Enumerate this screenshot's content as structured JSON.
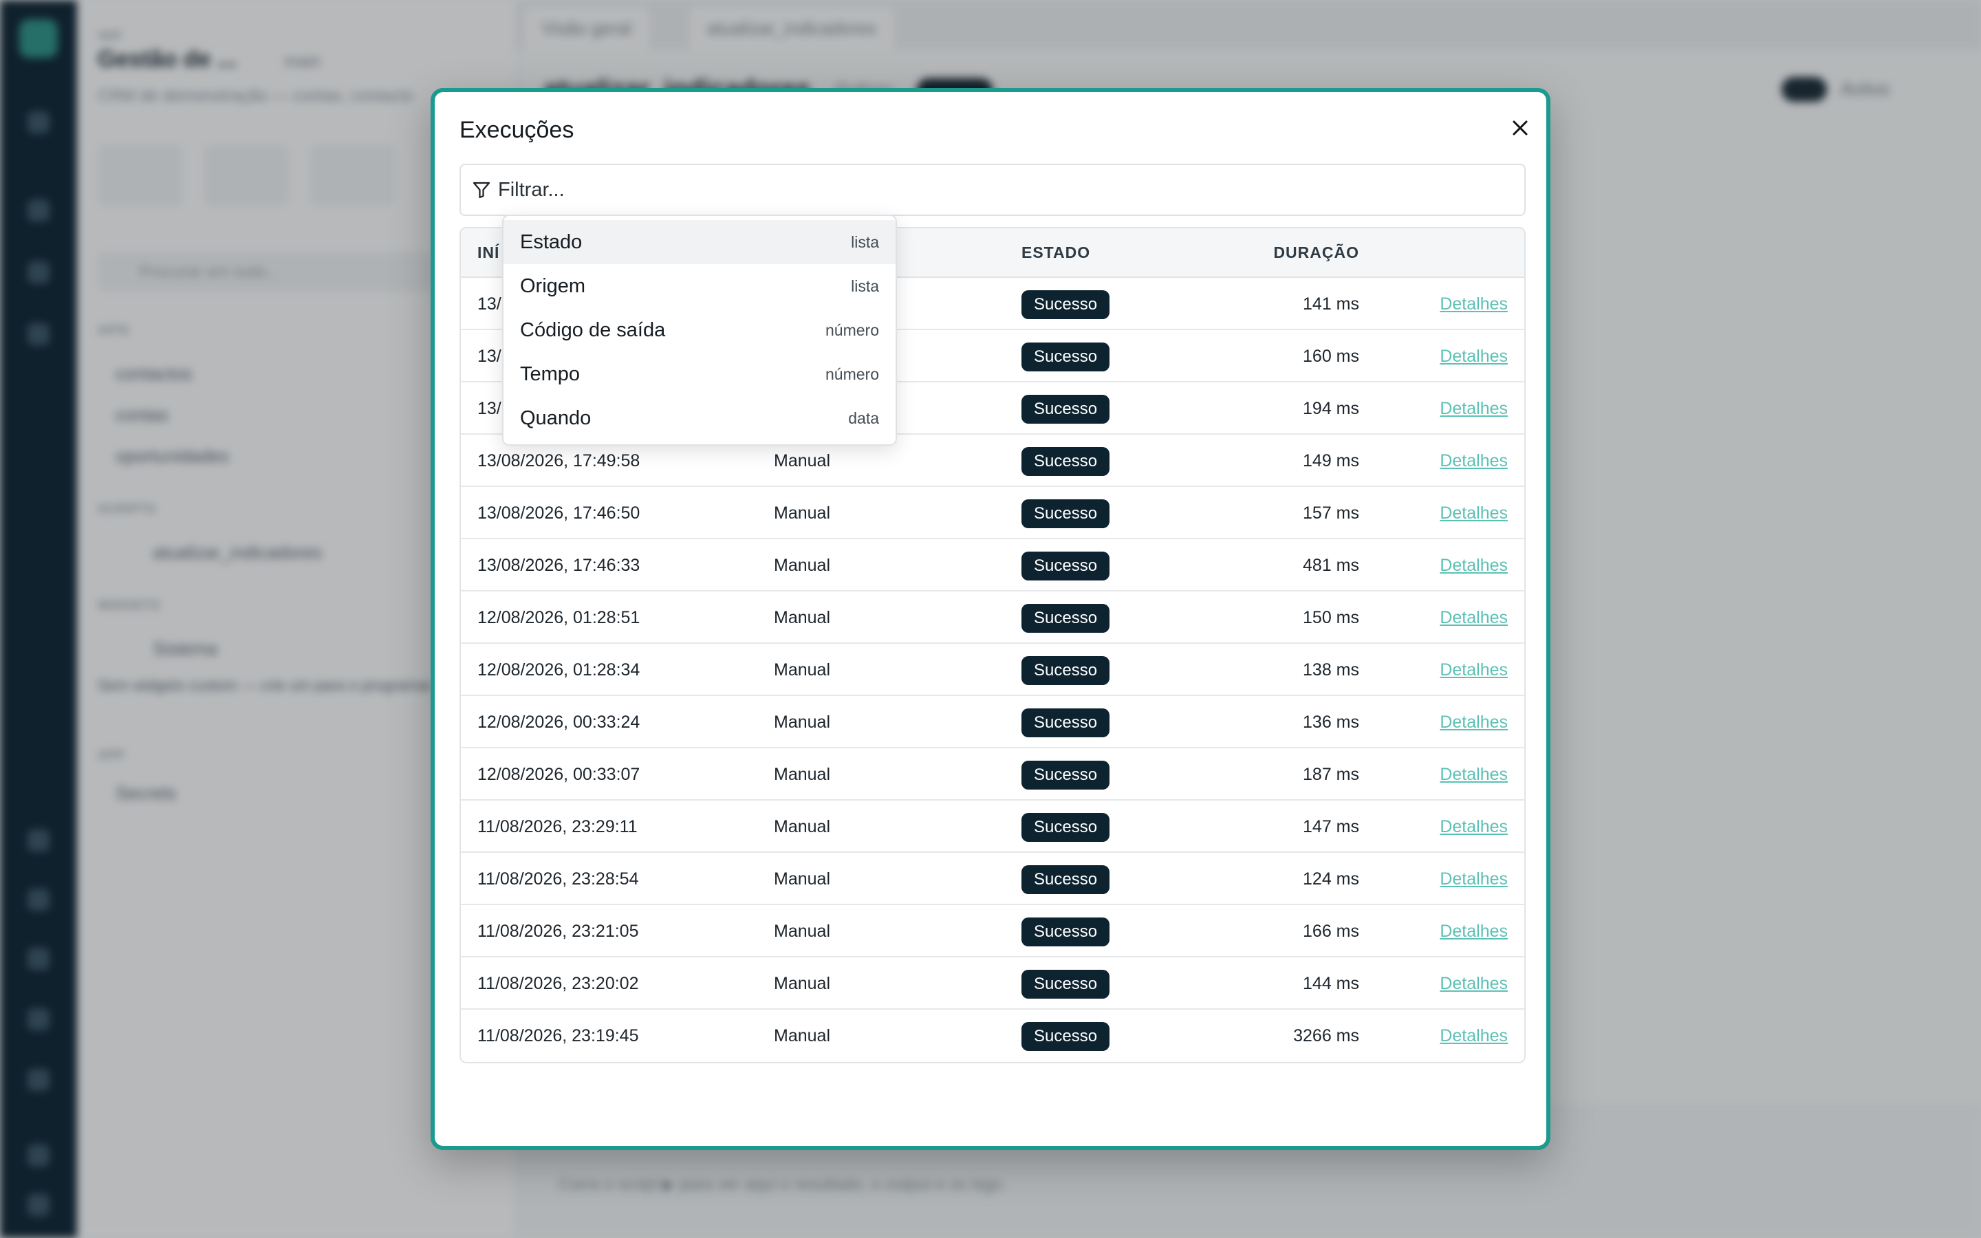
{
  "background": {
    "panel_kicker": "appl",
    "panel_title": "Gestão de ...",
    "panel_branch": "main",
    "panel_desc": "CRM de demonstração — contas, contacto",
    "search_placeholder": "Procurar em tudo...",
    "sections": [
      "APIS",
      "SCRIPTS",
      "WIDGETS",
      "APP"
    ],
    "api_items": [
      "contactos",
      "contas",
      "oportunidades"
    ],
    "script_item": "atualizar_indicadores",
    "widget_item": "Sistema",
    "widget_note": "Sem widgets custom — crie um para o programar.",
    "app_item": "Secrets",
    "tabs": [
      "Visão geral",
      "atualizar_indicadores"
    ],
    "main_title": "atualizar_indicadores",
    "main_subtitle": "Python",
    "toggle_label": "Activo",
    "footer_text": "Corra o script ▶ para ver aqui o resultado, o output e os logs."
  },
  "modal": {
    "title": "Execuções",
    "close_icon": "close-icon",
    "filter_placeholder": "Filtrar..."
  },
  "filter_menu": [
    {
      "label": "Estado",
      "type": "lista"
    },
    {
      "label": "Origem",
      "type": "lista"
    },
    {
      "label": "Código de saída",
      "type": "número"
    },
    {
      "label": "Tempo",
      "type": "número"
    },
    {
      "label": "Quando",
      "type": "data"
    }
  ],
  "table": {
    "headers": {
      "start": "INÍ",
      "state": "ESTADO",
      "duration": "DURAÇÃO"
    },
    "rows": [
      {
        "start": "13/",
        "origin": "",
        "state": "Sucesso",
        "duration": "141 ms",
        "details": "Detalhes"
      },
      {
        "start": "13/",
        "origin": "",
        "state": "Sucesso",
        "duration": "160 ms",
        "details": "Detalhes"
      },
      {
        "start": "13/",
        "origin": "",
        "state": "Sucesso",
        "duration": "194 ms",
        "details": "Detalhes"
      },
      {
        "start": "13/08/2026, 17:49:58",
        "origin": "Manual",
        "state": "Sucesso",
        "duration": "149 ms",
        "details": "Detalhes"
      },
      {
        "start": "13/08/2026, 17:46:50",
        "origin": "Manual",
        "state": "Sucesso",
        "duration": "157 ms",
        "details": "Detalhes"
      },
      {
        "start": "13/08/2026, 17:46:33",
        "origin": "Manual",
        "state": "Sucesso",
        "duration": "481 ms",
        "details": "Detalhes"
      },
      {
        "start": "12/08/2026, 01:28:51",
        "origin": "Manual",
        "state": "Sucesso",
        "duration": "150 ms",
        "details": "Detalhes"
      },
      {
        "start": "12/08/2026, 01:28:34",
        "origin": "Manual",
        "state": "Sucesso",
        "duration": "138 ms",
        "details": "Detalhes"
      },
      {
        "start": "12/08/2026, 00:33:24",
        "origin": "Manual",
        "state": "Sucesso",
        "duration": "136 ms",
        "details": "Detalhes"
      },
      {
        "start": "12/08/2026, 00:33:07",
        "origin": "Manual",
        "state": "Sucesso",
        "duration": "187 ms",
        "details": "Detalhes"
      },
      {
        "start": "11/08/2026, 23:29:11",
        "origin": "Manual",
        "state": "Sucesso",
        "duration": "147 ms",
        "details": "Detalhes"
      },
      {
        "start": "11/08/2026, 23:28:54",
        "origin": "Manual",
        "state": "Sucesso",
        "duration": "124 ms",
        "details": "Detalhes"
      },
      {
        "start": "11/08/2026, 23:21:05",
        "origin": "Manual",
        "state": "Sucesso",
        "duration": "166 ms",
        "details": "Detalhes"
      },
      {
        "start": "11/08/2026, 23:20:02",
        "origin": "Manual",
        "state": "Sucesso",
        "duration": "144 ms",
        "details": "Detalhes"
      },
      {
        "start": "11/08/2026, 23:19:45",
        "origin": "Manual",
        "state": "Sucesso",
        "duration": "3266 ms",
        "details": "Detalhes"
      }
    ]
  },
  "colors": {
    "accent": "#1b9a8e",
    "badge_bg": "#0e2330",
    "link": "#5cc1b5",
    "rail": "#0f2433"
  }
}
